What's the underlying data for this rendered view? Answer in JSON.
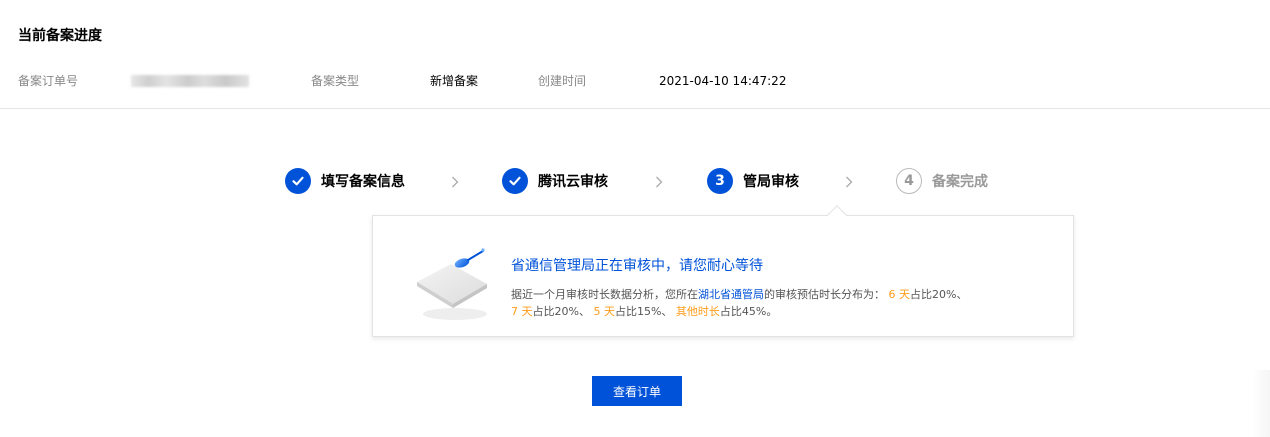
{
  "header": {
    "title": "当前备案进度"
  },
  "info": {
    "order_no_label": "备案订单号",
    "type_label": "备案类型",
    "type_value": "新增备案",
    "created_label": "创建时间",
    "created_value": "2021-04-10 14:47:22"
  },
  "steps": [
    {
      "label": "填写备案信息",
      "status": "done",
      "icon": "check-icon"
    },
    {
      "label": "腾讯云审核",
      "status": "done",
      "icon": "check-icon"
    },
    {
      "number": "3",
      "label": "管局审核",
      "status": "active"
    },
    {
      "number": "4",
      "label": "备案完成",
      "status": "pending"
    }
  ],
  "panel": {
    "title": "省通信管理局正在审核中，请您耐心等待",
    "desc_p1": "据近一个月审核时长数据分析，您所在",
    "desc_bureau": "湖北省通管局",
    "desc_p2": "的审核预估时长分布为：",
    "d1": "6 天",
    "d1_pct": "占比20%、",
    "d2": "7 天",
    "d2_pct": "占比20%、",
    "d3": "5 天",
    "d3_pct": "占比15%、",
    "d4": "其他时长",
    "d4_pct": "占比45%。"
  },
  "button": {
    "label": "查看订单"
  },
  "colors": {
    "primary": "#0052d9",
    "highlight": "#ff9c19",
    "muted": "#888888"
  }
}
